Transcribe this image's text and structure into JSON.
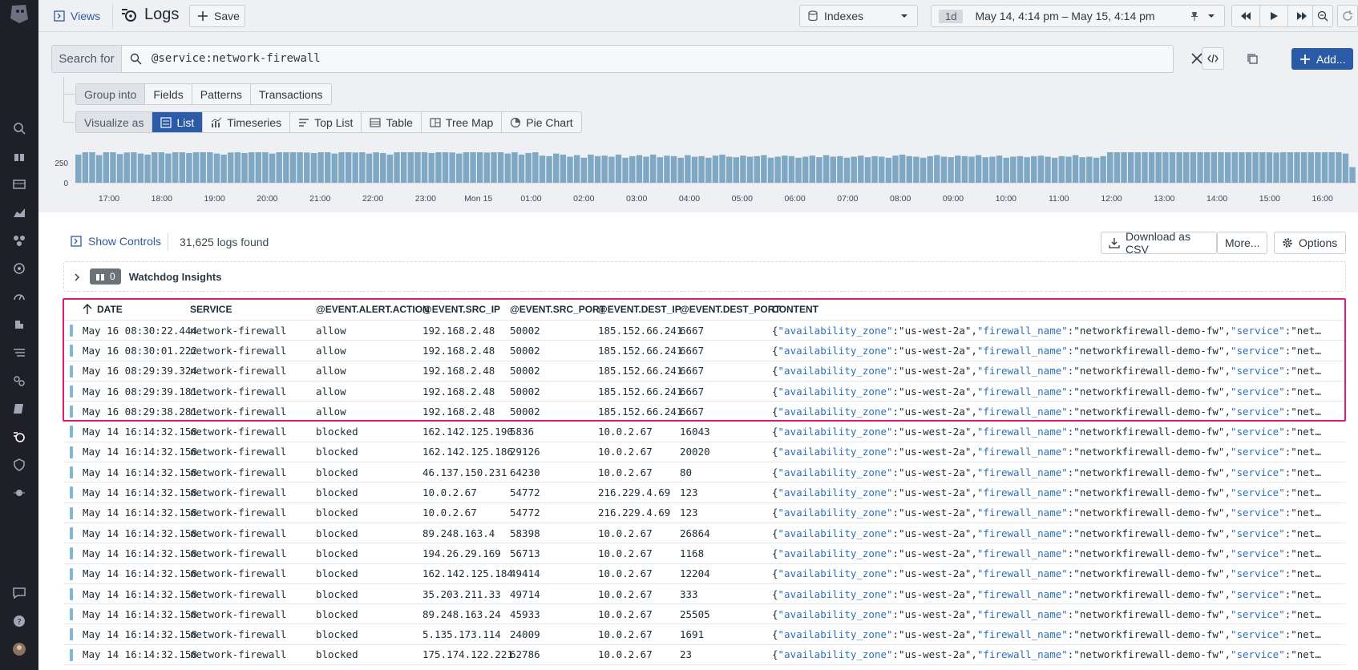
{
  "toolbar": {
    "views_label": "Views",
    "title": "Logs",
    "save_label": "Save",
    "indexes_label": "Indexes",
    "time_preset": "1d",
    "time_range": "May 14, 4:14 pm – May 15, 4:14 pm"
  },
  "search": {
    "label": "Search for",
    "query_key": "@service",
    "query_sep": ":",
    "query_value": "network-firewall",
    "add_label": "Add..."
  },
  "group_into": {
    "label": "Group into",
    "options": [
      "Fields",
      "Patterns",
      "Transactions"
    ]
  },
  "visualize_as": {
    "label": "Visualize as",
    "options": [
      "List",
      "Timeseries",
      "Top List",
      "Table",
      "Tree Map",
      "Pie Chart"
    ],
    "selected": "List"
  },
  "chart_data": {
    "type": "bar",
    "y_ticks": [
      "250",
      "0"
    ],
    "ylim": [
      0,
      400
    ],
    "x_ticks": [
      "17:00",
      "18:00",
      "19:00",
      "20:00",
      "21:00",
      "22:00",
      "23:00",
      "Mon 15",
      "01:00",
      "02:00",
      "03:00",
      "04:00",
      "05:00",
      "06:00",
      "07:00",
      "08:00",
      "09:00",
      "10:00",
      "11:00",
      "12:00",
      "13:00",
      "14:00",
      "15:00",
      "16:00"
    ],
    "color": "#7fa8c5",
    "values": [
      270,
      300,
      310,
      265,
      295,
      305,
      275,
      290,
      300,
      280,
      270,
      300,
      310,
      280,
      295,
      300,
      285,
      300,
      305,
      310,
      280,
      270,
      290,
      305,
      285,
      300,
      310,
      295,
      280,
      300,
      320,
      315,
      300,
      290,
      285,
      300,
      310,
      280,
      295,
      300,
      290,
      305,
      280,
      300,
      285,
      270,
      310,
      300,
      295,
      320,
      305,
      285,
      300,
      310,
      290,
      280,
      300,
      315,
      305,
      290,
      295,
      300,
      280,
      300,
      270,
      285,
      300,
      260,
      255,
      280,
      270,
      250,
      265,
      240,
      270,
      255,
      260,
      250,
      270,
      240,
      255,
      265,
      250,
      270,
      245,
      260,
      255,
      240,
      265,
      250,
      255,
      240,
      260,
      270,
      250,
      245,
      260,
      250,
      255,
      265,
      240,
      250,
      260,
      255,
      240,
      250,
      260,
      245,
      265,
      250,
      255,
      240,
      250,
      260,
      245,
      255,
      250,
      240,
      260,
      270,
      255,
      250,
      240,
      255,
      265,
      250,
      245,
      260,
      255,
      250,
      265,
      245,
      250,
      260,
      240,
      250,
      255,
      245,
      255,
      260,
      250,
      240,
      255,
      250,
      265,
      245,
      250,
      240,
      255,
      330,
      310,
      320,
      300,
      315,
      330,
      305,
      320,
      310,
      300,
      340,
      320,
      330,
      360,
      350,
      340,
      320,
      330,
      310,
      300,
      340,
      320,
      300,
      310,
      290,
      330,
      310,
      300,
      320,
      310,
      350,
      330,
      300,
      310,
      280,
      150
    ]
  },
  "results": {
    "show_controls": "Show Controls",
    "count": "31,625 logs found",
    "download_label": "Download as CSV",
    "more_label": "More...",
    "options_label": "Options",
    "watchdog_count": "0",
    "watchdog_label": "Watchdog Insights"
  },
  "table": {
    "columns": [
      "DATE",
      "SERVICE",
      "@EVENT.ALERT.ACTION",
      "@EVENT.SRC_IP",
      "@EVENT.SRC_PORT",
      "@EVENT.DEST_IP",
      "@EVENT.DEST_PORT",
      "CONTENT"
    ],
    "content_prefix": "{",
    "content_k1": "\"availability_zone\"",
    "content_v1": ":\"us-west-2a\",",
    "content_k2": "\"firewall_name\"",
    "content_v2": ":\"networkfirewall-demo-fw\",",
    "content_k3": "\"service\"",
    "content_v3": ":\"net…",
    "rows": [
      [
        "May 16 08:30:22.444",
        "network-firewall",
        "allow",
        "192.168.2.48",
        "50002",
        "185.152.66.241",
        "6667"
      ],
      [
        "May 16 08:30:01.222",
        "network-firewall",
        "allow",
        "192.168.2.48",
        "50002",
        "185.152.66.241",
        "6667"
      ],
      [
        "May 16 08:29:39.324",
        "network-firewall",
        "allow",
        "192.168.2.48",
        "50002",
        "185.152.66.241",
        "6667"
      ],
      [
        "May 16 08:29:39.181",
        "network-firewall",
        "allow",
        "192.168.2.48",
        "50002",
        "185.152.66.241",
        "6667"
      ],
      [
        "May 16 08:29:38.281",
        "network-firewall",
        "allow",
        "192.168.2.48",
        "50002",
        "185.152.66.241",
        "6667"
      ],
      [
        "May 14 16:14:32.158",
        "network-firewall",
        "blocked",
        "162.142.125.190",
        "5836",
        "10.0.2.67",
        "16043"
      ],
      [
        "May 14 16:14:32.158",
        "network-firewall",
        "blocked",
        "162.142.125.186",
        "29126",
        "10.0.2.67",
        "20020"
      ],
      [
        "May 14 16:14:32.158",
        "network-firewall",
        "blocked",
        "46.137.150.231",
        "64230",
        "10.0.2.67",
        "80"
      ],
      [
        "May 14 16:14:32.158",
        "network-firewall",
        "blocked",
        "10.0.2.67",
        "54772",
        "216.229.4.69",
        "123"
      ],
      [
        "May 14 16:14:32.158",
        "network-firewall",
        "blocked",
        "10.0.2.67",
        "54772",
        "216.229.4.69",
        "123"
      ],
      [
        "May 14 16:14:32.158",
        "network-firewall",
        "blocked",
        "89.248.163.4",
        "58398",
        "10.0.2.67",
        "26864"
      ],
      [
        "May 14 16:14:32.158",
        "network-firewall",
        "blocked",
        "194.26.29.169",
        "56713",
        "10.0.2.67",
        "1168"
      ],
      [
        "May 14 16:14:32.158",
        "network-firewall",
        "blocked",
        "162.142.125.184",
        "49414",
        "10.0.2.67",
        "12204"
      ],
      [
        "May 14 16:14:32.158",
        "network-firewall",
        "blocked",
        "35.203.211.33",
        "49714",
        "10.0.2.67",
        "333"
      ],
      [
        "May 14 16:14:32.158",
        "network-firewall",
        "blocked",
        "89.248.163.24",
        "45933",
        "10.0.2.67",
        "25505"
      ],
      [
        "May 14 16:14:32.158",
        "network-firewall",
        "blocked",
        "5.135.173.114",
        "24009",
        "10.0.2.67",
        "1691"
      ],
      [
        "May 14 16:14:32.158",
        "network-firewall",
        "blocked",
        "175.174.122.221",
        "62786",
        "10.0.2.67",
        "23"
      ]
    ]
  }
}
